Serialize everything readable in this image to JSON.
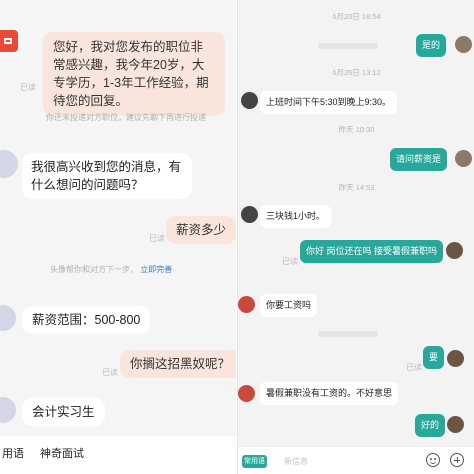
{
  "left": {
    "read_label": "已读",
    "msg1": "您好，我对您发布的职位非常感兴趣，我今年20岁，大专学历，1-3年工作经验，期待您的回复。",
    "notice1": "你还未投递对方职位，建议先聊下再进行投递",
    "msg2": "我很高兴收到您的消息，有什么想问的问题吗？",
    "msg3": "薪资多少",
    "notice2_text": "头像帮你和对方下一步",
    "notice2_link": "立即完善",
    "msg4": "薪资范围：500-800",
    "msg5": "你搁这招黑奴呢？",
    "msg6": "会计实习生",
    "chips": [
      "用语",
      "神奇面试"
    ]
  },
  "right": {
    "times": [
      "6月20日 18:54",
      "6月26日 13:12",
      "昨天 10:30",
      "昨天 14:53"
    ],
    "msg_shi_de": "是的",
    "msg_hours": "上班时间下午5:30到晚上9:30。",
    "msg_ask_salary": "请问薪资是",
    "msg_rate": "三块钱1小时。",
    "msg_position": "你好 岗位还在吗 接受暑假兼职吗",
    "msg_need_pay": "你要工资吗",
    "msg_yao": "要",
    "msg_no_pay": "暑假兼职没有工资的。不好意思",
    "msg_ok": "好的",
    "read_label": "已读",
    "phrase_button": "常用语",
    "input_placeholder": "新信息"
  },
  "colors": {
    "out_bubble_right": "#27a89a",
    "out_bubble_left": "#f9e5dc",
    "link_blue": "#3a7bd5"
  }
}
